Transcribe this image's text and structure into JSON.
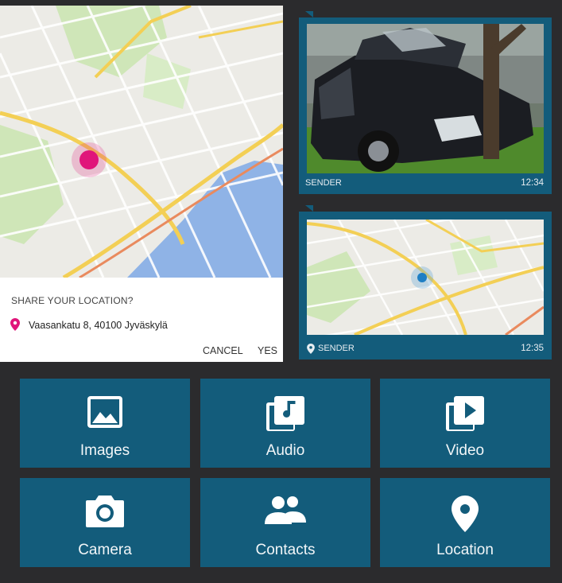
{
  "share": {
    "title": "SHARE YOUR LOCATION?",
    "address": "Vaasankatu 8, 40100 Jyväskylä",
    "cancel_label": "CANCEL",
    "yes_label": "YES",
    "accent_color": "#e0157a"
  },
  "messages": [
    {
      "sender": "SENDER",
      "time": "12:34",
      "type": "photo"
    },
    {
      "sender": "SENDER",
      "time": "12:35",
      "type": "location"
    }
  ],
  "tiles": [
    {
      "label": "Images",
      "icon": "image-icon"
    },
    {
      "label": "Audio",
      "icon": "audio-icon"
    },
    {
      "label": "Video",
      "icon": "video-icon"
    },
    {
      "label": "Camera",
      "icon": "camera-icon"
    },
    {
      "label": "Contacts",
      "icon": "contacts-icon"
    },
    {
      "label": "Location",
      "icon": "location-pin-icon"
    }
  ],
  "colors": {
    "background": "#2b2b2d",
    "tile": "#135c7b",
    "map_water": "#8fb3e6",
    "map_park": "#cde6b6",
    "map_road": "#f3d36a"
  }
}
